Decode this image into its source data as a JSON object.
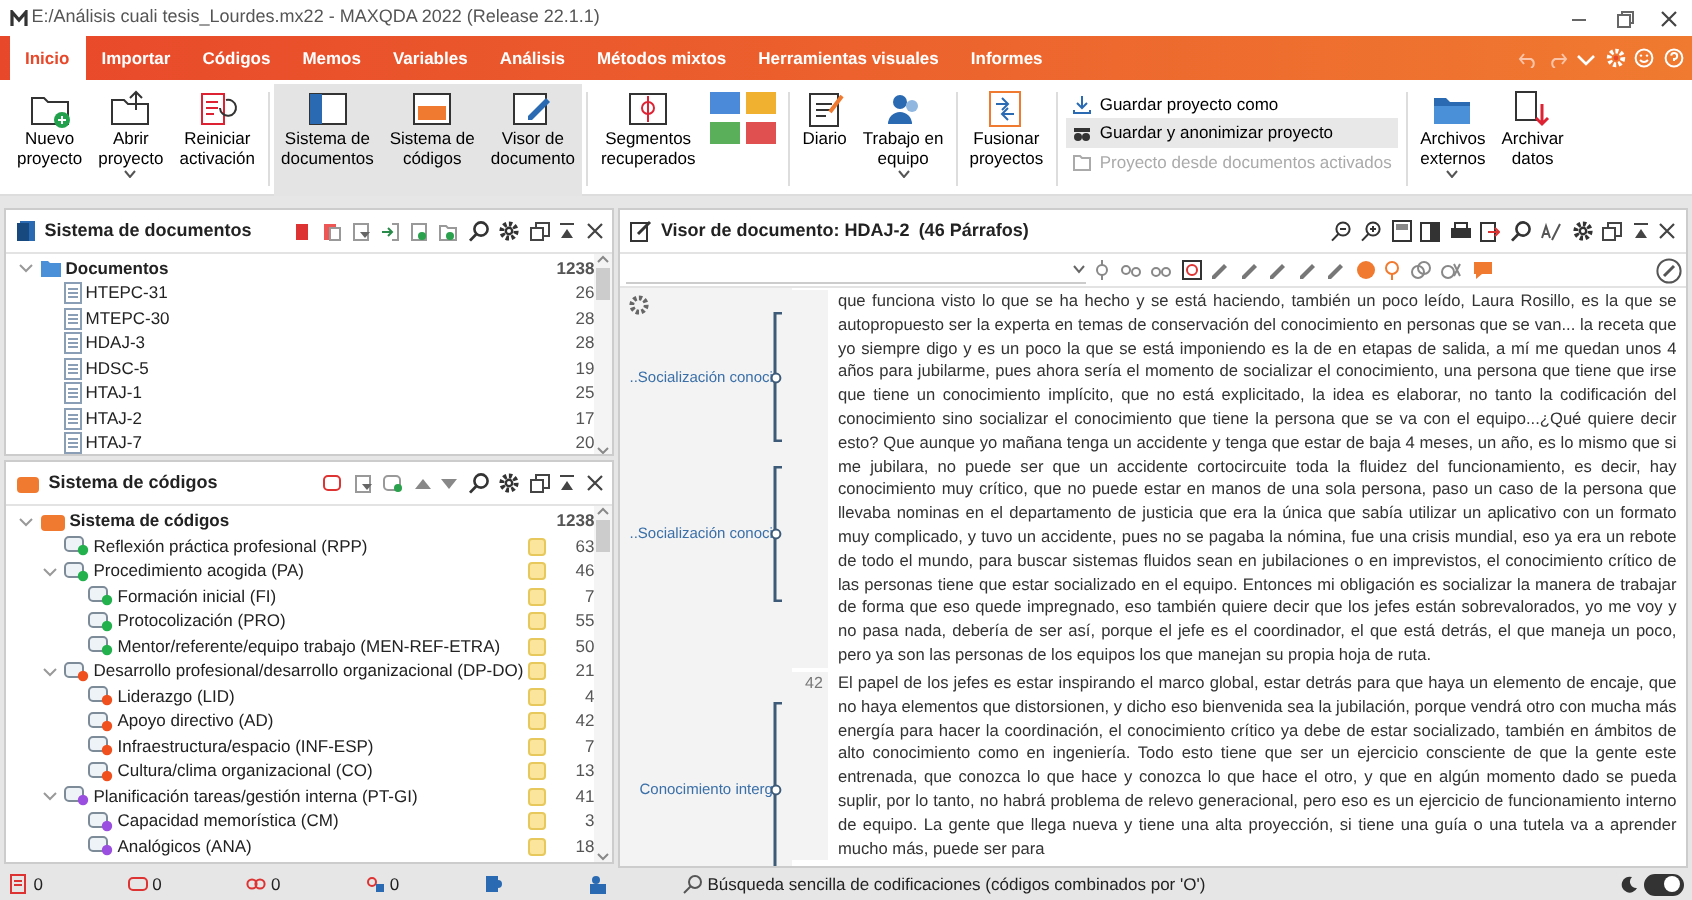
{
  "window": {
    "title": "E:/Análisis cuali tesis_Lourdes.mx22 - MAXQDA 2022 (Release 22.1.1)"
  },
  "ribbon": {
    "tabs": [
      {
        "label": "Inicio",
        "selected": true
      },
      {
        "label": "Importar",
        "selected": false
      },
      {
        "label": "Códigos",
        "selected": false
      },
      {
        "label": "Memos",
        "selected": false
      },
      {
        "label": "Variables",
        "selected": false
      },
      {
        "label": "Análisis",
        "selected": false
      },
      {
        "label": "Métodos mixtos",
        "selected": false
      },
      {
        "label": "Herramientas visuales",
        "selected": false
      },
      {
        "label": "Informes",
        "selected": false
      }
    ],
    "tools": [
      {
        "lines": [
          "Nuevo",
          "proyecto"
        ],
        "selected": false,
        "dropdown": false
      },
      {
        "lines": [
          "Abrir",
          "proyecto"
        ],
        "selected": false,
        "dropdown": true
      },
      {
        "lines": [
          "Reiniciar",
          "activación"
        ],
        "selected": false,
        "dropdown": false
      },
      {
        "lines": [
          "Sistema de",
          "documentos"
        ],
        "selected": true,
        "dropdown": false
      },
      {
        "lines": [
          "Sistema de",
          "códigos"
        ],
        "selected": true,
        "dropdown": false
      },
      {
        "lines": [
          "Visor de",
          "documento"
        ],
        "selected": true,
        "dropdown": false
      },
      {
        "lines": [
          "Segmentos",
          "recuperados"
        ],
        "selected": false,
        "dropdown": false
      },
      {
        "lines": [
          "Diario"
        ],
        "selected": false,
        "dropdown": false
      },
      {
        "lines": [
          "Trabajo en",
          "equipo"
        ],
        "selected": false,
        "dropdown": true
      },
      {
        "lines": [
          "Fusionar",
          "proyectos"
        ],
        "selected": false,
        "dropdown": false
      }
    ],
    "save_options": [
      {
        "label": "Guardar proyecto como",
        "selected": false,
        "disabled": false
      },
      {
        "label": "Guardar y anonimizar proyecto",
        "selected": true,
        "disabled": false
      },
      {
        "label": "Proyecto desde documentos activados",
        "selected": false,
        "disabled": true
      }
    ],
    "archive_tools": [
      {
        "lines": [
          "Archivos",
          "externos"
        ],
        "dropdown": true
      },
      {
        "lines": [
          "Archivar",
          "datos"
        ],
        "dropdown": false
      }
    ]
  },
  "document_system": {
    "title": "Sistema de documentos",
    "root": {
      "label": "Documentos",
      "count": "1238",
      "expanded": true,
      "children": [
        {
          "label": "HTEPC-31",
          "count": "26"
        },
        {
          "label": "MTEPC-30",
          "count": "28"
        },
        {
          "label": "HDAJ-3",
          "count": "28"
        },
        {
          "label": "HDSC-5",
          "count": "19"
        },
        {
          "label": "HTAJ-1",
          "count": "25"
        },
        {
          "label": "HTAJ-2",
          "count": "17"
        },
        {
          "label": "HTAJ-7",
          "count": "20"
        }
      ]
    }
  },
  "code_system": {
    "title": "Sistema de códigos",
    "root": {
      "label": "Sistema de códigos",
      "count": "1238",
      "expanded": true,
      "children": [
        {
          "label": "Reflexión práctica profesional (RPP)",
          "count": "63",
          "color": "#22b14c",
          "memo": true
        },
        {
          "label": "Procedimiento acogida (PA)",
          "count": "46",
          "color": "#22b14c",
          "memo": true,
          "expanded": true,
          "children": [
            {
              "label": "Formación inicial (FI)",
              "count": "7",
              "color": "#22b14c",
              "memo": true
            },
            {
              "label": "Protocolización (PRO)",
              "count": "55",
              "color": "#22b14c",
              "memo": true
            },
            {
              "label": "Mentor/referente/equipo trabajo (MEN-REF-ETRA)",
              "count": "50",
              "color": "#22b14c",
              "memo": true
            }
          ]
        },
        {
          "label": "Desarrollo profesional/desarrollo organizacional (DP-DO)",
          "count": "21",
          "color": "#f0501e",
          "memo": true,
          "expanded": true,
          "children": [
            {
              "label": "Liderazgo (LID)",
              "count": "4",
              "color": "#f0501e",
              "memo": true
            },
            {
              "label": "Apoyo directivo (AD)",
              "count": "42",
              "color": "#f0501e",
              "memo": true
            },
            {
              "label": "Infraestructura/espacio (INF-ESP)",
              "count": "7",
              "color": "#f0501e",
              "memo": true
            },
            {
              "label": "Cultura/clima organizacional (CO)",
              "count": "13",
              "color": "#f0501e",
              "memo": true
            }
          ]
        },
        {
          "label": "Planificación tareas/gestión interna (PT-GI)",
          "count": "41",
          "color": "#9b4fe0",
          "memo": true,
          "expanded": true,
          "children": [
            {
              "label": "Capacidad memorística (CM)",
              "count": "3",
              "color": "#9b4fe0",
              "memo": true
            },
            {
              "label": "Analógicos (ANA)",
              "count": "18",
              "color": "#9b4fe0",
              "memo": true
            }
          ]
        }
      ]
    }
  },
  "document_viewer": {
    "title": "Visor de documento: HDAJ-2",
    "paragraph_count": "(46 Párrafos)",
    "codings": [
      {
        "label": "..Socialización conoci"
      },
      {
        "label": "..Socialización conoci"
      },
      {
        "label": "Conocimiento interg"
      }
    ],
    "paragraphs": [
      {
        "text": "que funciona visto lo que se ha hecho y se está haciendo, también un poco leído, Laura Rosillo, es la que se autopropuesto ser la experta en temas de conservación del conocimiento en personas que se van... la receta que yo siempre digo y es un poco la que se está imponiendo es la de en etapas de salida, a mí me quedan unos 4 años para jubilarme, pues ahora sería el momento de socializar el conocimiento, una persona que tiene que irse que tiene un conocimiento implícito, que no está explicitado, la idea es elaborar, no tanto la codificación del conocimiento sino socializar el conocimiento que tiene la persona que se va con el equipo...¿Qué quiere decir esto? Que aunque yo mañana tenga un accidente y tenga que estar de baja 4 meses, un año, es lo mismo que si me jubilara, no puede ser que un accidente cortocircuite toda la fluidez del funcionamiento, es decir, hay conocimiento muy crítico, que no puede estar en manos de una sola persona, paso un caso de la persona que llevaba nominas en el departamento de justicia que era la única que sabía utilizar un aplicativo con un formato muy complicado, y tuvo un accidente, pues no se pagaba la nómina, fue una crisis mundial, eso ya era un rebote de todo el mundo, para buscar sistemas fluidos sean en jubilaciones o en imprevistos, el conocimiento crítico de las personas tiene que estar socializado en el equipo. Entonces mi obligación es socializar la manera de trabajar de forma que eso quede impregnado, eso también quiere decir que los jefes están sobrevalorados, yo me voy y no pasa nada, debería de ser así, porque el jefe es el coordinador, el que está detrás, el que maneja un poco, pero ya son las personas de los equipos los que manejan su propia hoja de ruta."
      },
      {
        "number": "42",
        "text": "El papel de los jefes es estar inspirando el marco global, estar detrás para que haya un elemento de encaje, que no haya elementos que distorsionen, y dicho eso bienvenida sea la jubilación, porque vendrá otro con mucha más energía para hacer la coordinación, el conocimiento crítico ya debe de estar socializado, también en ámbitos de alto conocimiento como en ingeniería. Todo esto tiene que ser un ejercicio consciente de que la gente este entrenada, que conozca lo que hace y conozca lo que hace el otro, y que en algún momento dado se pueda suplir, por lo tanto, no habrá problema de relevo generacional, pero eso es un ejercicio de funcionamiento interno de equipo. La gente que llega nueva y tiene una alta proyección, si tiene una guía o una tutela va a aprender mucho más, puede ser para"
      }
    ]
  },
  "status_bar": {
    "counters": [
      "0",
      "0",
      "0",
      "0"
    ],
    "search_mode": "Búsqueda sencilla de codificaciones (códigos combinados por 'O')",
    "dark_mode": {
      "on": true
    }
  }
}
